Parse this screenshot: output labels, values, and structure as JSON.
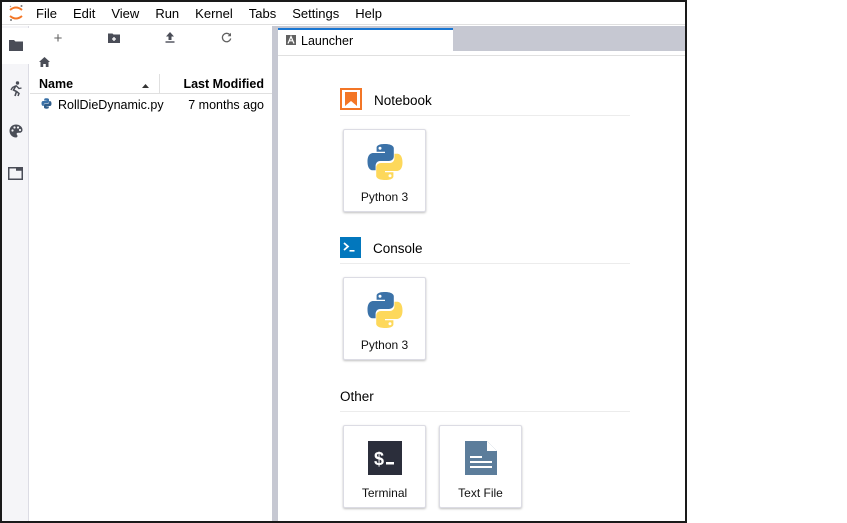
{
  "app": {
    "logo": "jupyter-logo-icon"
  },
  "menubar": {
    "items": [
      "File",
      "Edit",
      "View",
      "Run",
      "Kernel",
      "Tabs",
      "Settings",
      "Help"
    ]
  },
  "activitybar": {
    "items": [
      {
        "icon": "folder-icon",
        "label": "File Browser",
        "active": true
      },
      {
        "icon": "running-icon",
        "label": "Running Terminals and Kernels",
        "active": false
      },
      {
        "icon": "palette-icon",
        "label": "Commands",
        "active": false
      },
      {
        "icon": "tabs-icon",
        "label": "Open Tabs",
        "active": false
      }
    ]
  },
  "filebrowser": {
    "toolbar": [
      {
        "icon": "plus-icon",
        "label": "New Launcher"
      },
      {
        "icon": "new-folder-icon",
        "label": "New Folder"
      },
      {
        "icon": "upload-icon",
        "label": "Upload Files"
      },
      {
        "icon": "refresh-icon",
        "label": "Refresh File List"
      }
    ],
    "breadcrumb_icon": "home-icon",
    "columns": {
      "name": "Name",
      "modified": "Last Modified",
      "sort": "ascending"
    },
    "files": [
      {
        "name": "RollDieDynamic.py",
        "modified": "7 months ago",
        "type": "python"
      }
    ]
  },
  "tabs": [
    {
      "label": "Launcher",
      "icon": "launcher-icon",
      "active": true
    }
  ],
  "launcher": {
    "sections": [
      {
        "title": "Notebook",
        "icon": "notebook-icon",
        "icon_color": "#f37626",
        "cards": [
          {
            "label": "Python 3",
            "icon": "python-icon"
          }
        ]
      },
      {
        "title": "Console",
        "icon": "console-icon",
        "icon_color": "#0277bd",
        "cards": [
          {
            "label": "Python 3",
            "icon": "python-icon"
          }
        ]
      },
      {
        "title": "Other",
        "icon": null,
        "cards": [
          {
            "label": "Terminal",
            "icon": "terminal-icon"
          },
          {
            "label": "Text File",
            "icon": "text-file-icon"
          }
        ]
      }
    ]
  },
  "colors": {
    "accent": "#1976d2",
    "splitter": "#c6c8d2",
    "notebook_orange": "#f37626",
    "console_blue": "#0277bd",
    "terminal_dark": "#2b2e3b",
    "textfile_slate": "#5c7d9b"
  }
}
